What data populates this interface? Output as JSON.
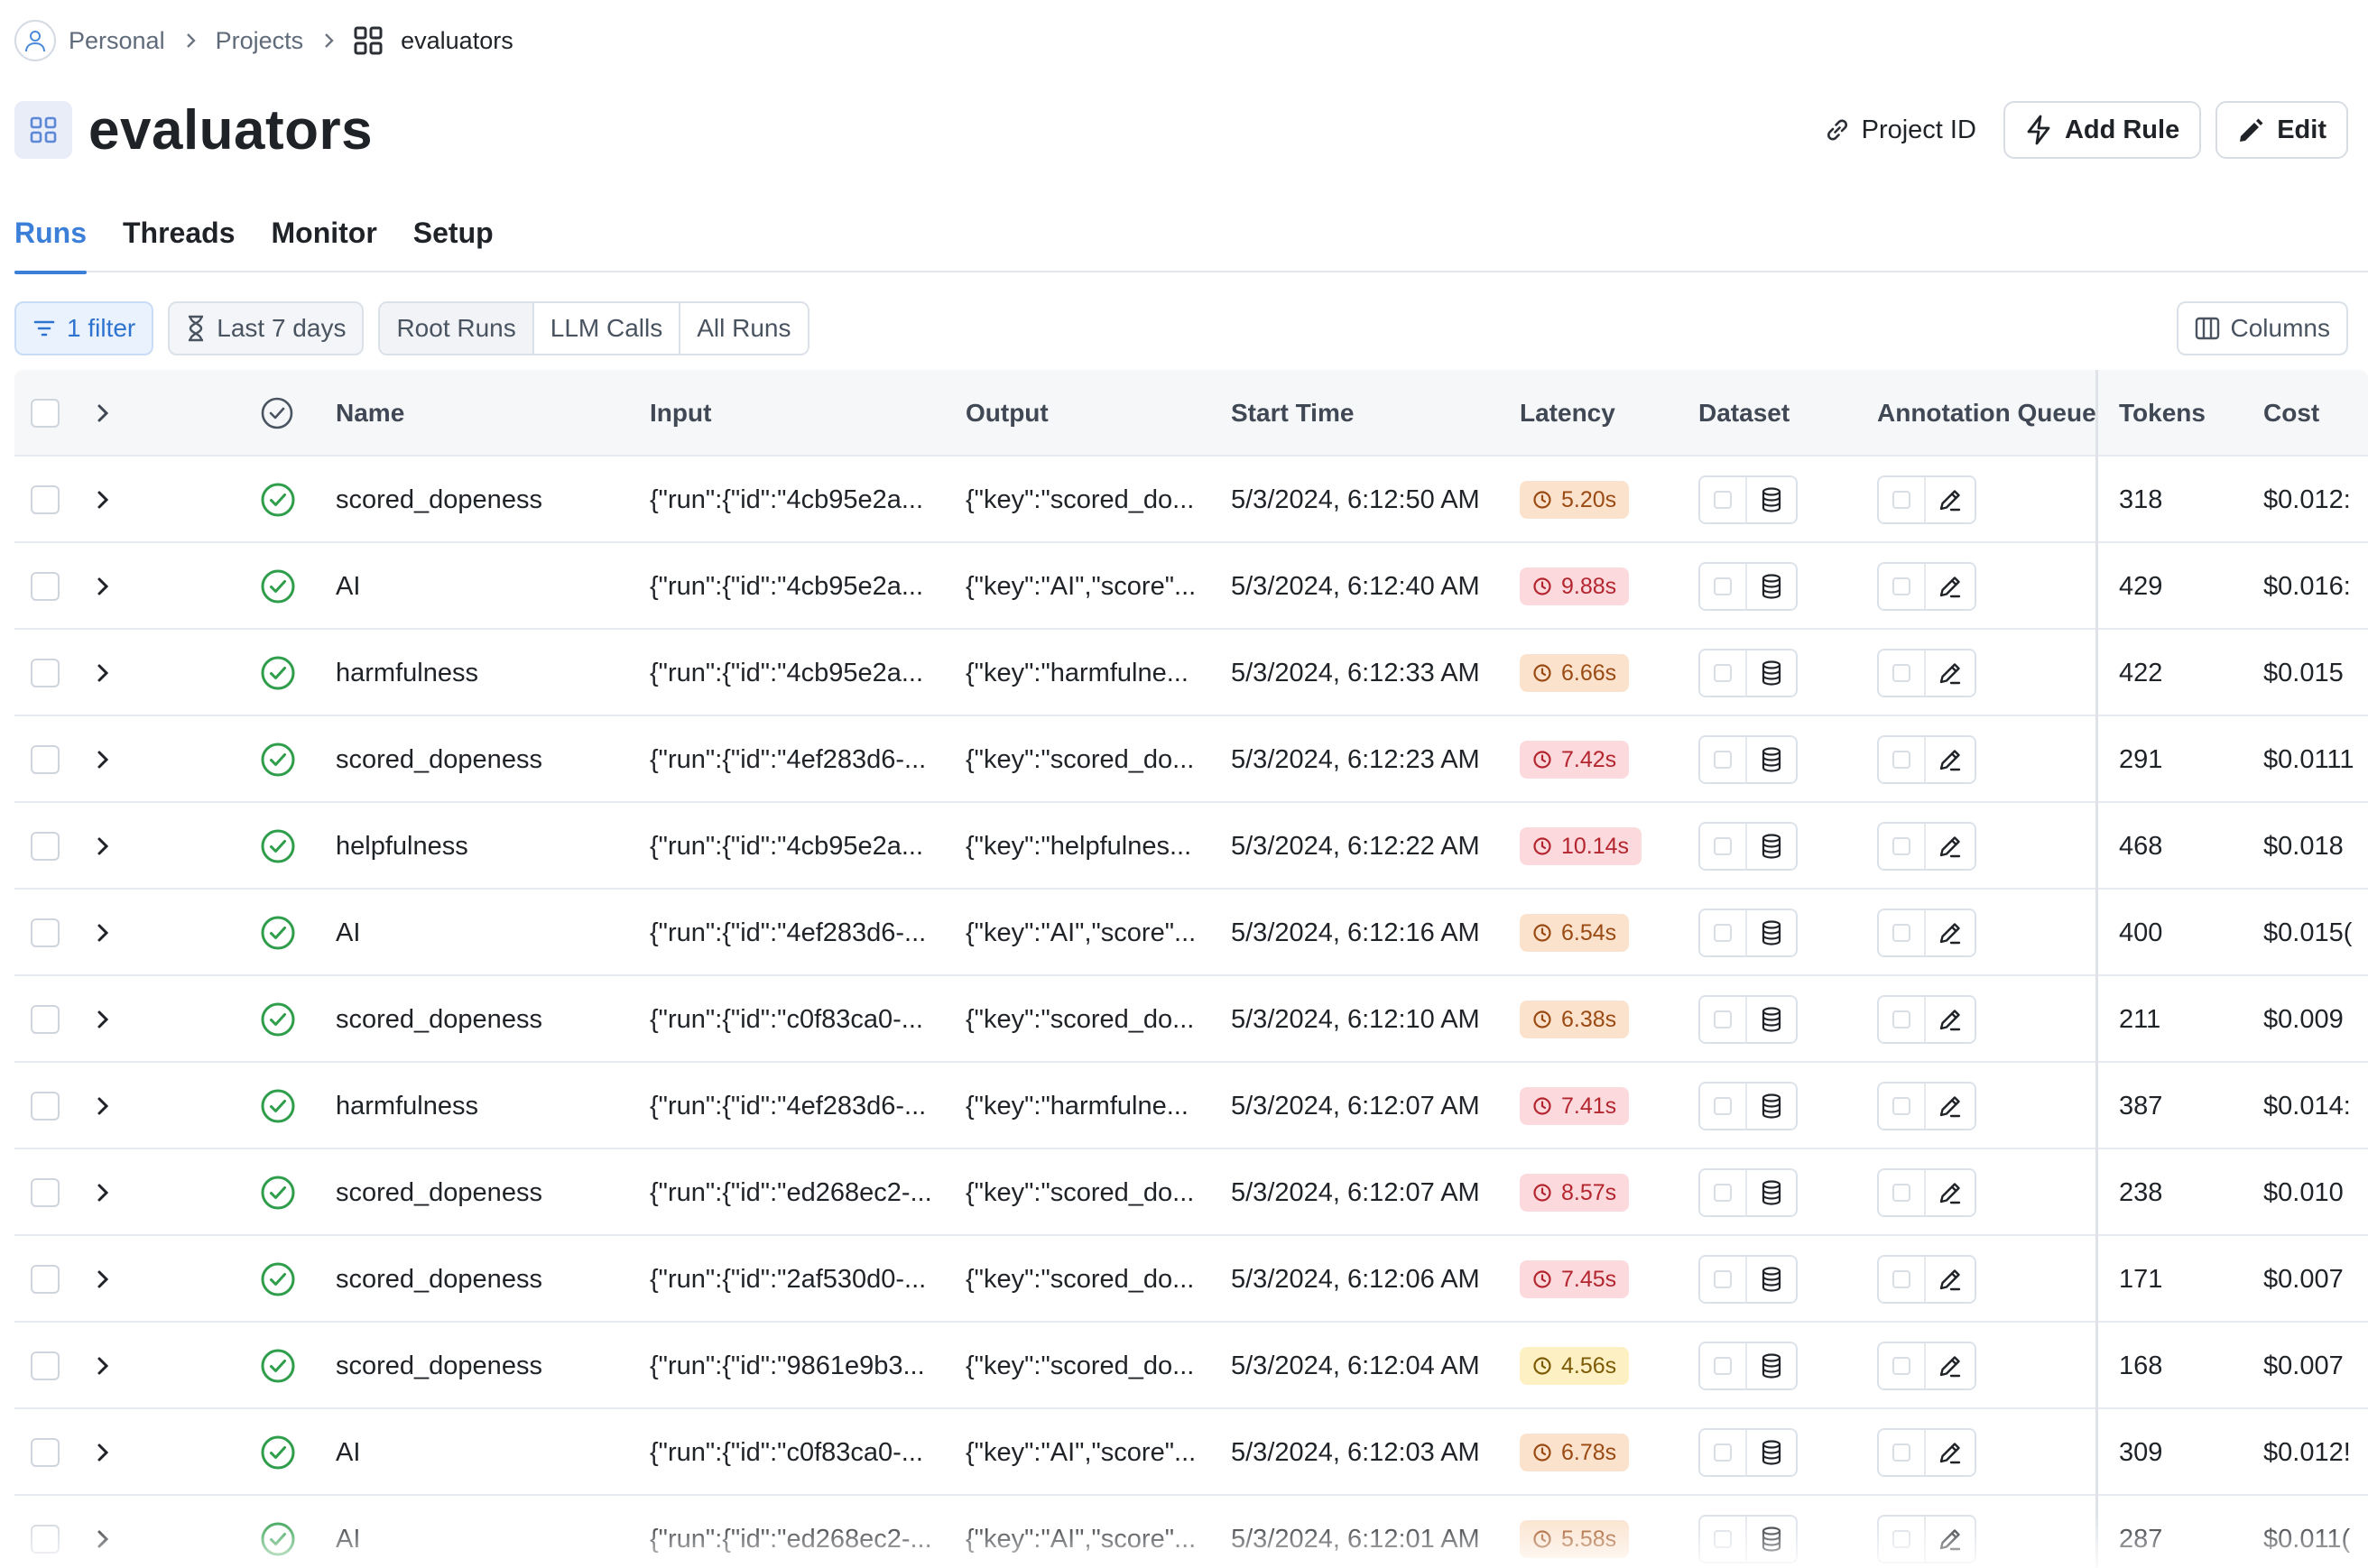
{
  "breadcrumb": {
    "items": [
      "Personal",
      "Projects"
    ],
    "current": "evaluators"
  },
  "header": {
    "title": "evaluators",
    "project_id_label": "Project ID",
    "add_rule_label": "Add Rule",
    "edit_label": "Edit"
  },
  "tabs": [
    {
      "label": "Runs",
      "active": true
    },
    {
      "label": "Threads",
      "active": false
    },
    {
      "label": "Monitor",
      "active": false
    },
    {
      "label": "Setup",
      "active": false
    }
  ],
  "toolbar": {
    "filter_label": "1 filter",
    "range_label": "Last 7 days",
    "run_types": [
      "Root Runs",
      "LLM Calls",
      "All Runs"
    ],
    "active_run_type": "Root Runs",
    "columns_label": "Columns"
  },
  "table": {
    "headers": {
      "name": "Name",
      "input": "Input",
      "output": "Output",
      "start": "Start Time",
      "latency": "Latency",
      "dataset": "Dataset",
      "queue": "Annotation Queue",
      "tokens": "Tokens",
      "cost": "Cost"
    },
    "rows": [
      {
        "name": "scored_dopeness",
        "input": "{\"run\":{\"id\":\"4cb95e2a...",
        "output": "{\"key\":\"scored_do...",
        "start": "5/3/2024, 6:12:50 AM",
        "latency": "5.20s",
        "latency_level": "orange",
        "tokens": "318",
        "cost": "$0.012:"
      },
      {
        "name": "AI",
        "input": "{\"run\":{\"id\":\"4cb95e2a...",
        "output": "{\"key\":\"AI\",\"score\"...",
        "start": "5/3/2024, 6:12:40 AM",
        "latency": "9.88s",
        "latency_level": "red",
        "tokens": "429",
        "cost": "$0.016:"
      },
      {
        "name": "harmfulness",
        "input": "{\"run\":{\"id\":\"4cb95e2a...",
        "output": "{\"key\":\"harmfulne...",
        "start": "5/3/2024, 6:12:33 AM",
        "latency": "6.66s",
        "latency_level": "orange",
        "tokens": "422",
        "cost": "$0.015"
      },
      {
        "name": "scored_dopeness",
        "input": "{\"run\":{\"id\":\"4ef283d6-...",
        "output": "{\"key\":\"scored_do...",
        "start": "5/3/2024, 6:12:23 AM",
        "latency": "7.42s",
        "latency_level": "red",
        "tokens": "291",
        "cost": "$0.0111"
      },
      {
        "name": "helpfulness",
        "input": "{\"run\":{\"id\":\"4cb95e2a...",
        "output": "{\"key\":\"helpfulnes...",
        "start": "5/3/2024, 6:12:22 AM",
        "latency": "10.14s",
        "latency_level": "red",
        "tokens": "468",
        "cost": "$0.018"
      },
      {
        "name": "AI",
        "input": "{\"run\":{\"id\":\"4ef283d6-...",
        "output": "{\"key\":\"AI\",\"score\"...",
        "start": "5/3/2024, 6:12:16 AM",
        "latency": "6.54s",
        "latency_level": "orange",
        "tokens": "400",
        "cost": "$0.015("
      },
      {
        "name": "scored_dopeness",
        "input": "{\"run\":{\"id\":\"c0f83ca0-...",
        "output": "{\"key\":\"scored_do...",
        "start": "5/3/2024, 6:12:10 AM",
        "latency": "6.38s",
        "latency_level": "orange",
        "tokens": "211",
        "cost": "$0.009"
      },
      {
        "name": "harmfulness",
        "input": "{\"run\":{\"id\":\"4ef283d6-...",
        "output": "{\"key\":\"harmfulne...",
        "start": "5/3/2024, 6:12:07 AM",
        "latency": "7.41s",
        "latency_level": "red",
        "tokens": "387",
        "cost": "$0.014:"
      },
      {
        "name": "scored_dopeness",
        "input": "{\"run\":{\"id\":\"ed268ec2-...",
        "output": "{\"key\":\"scored_do...",
        "start": "5/3/2024, 6:12:07 AM",
        "latency": "8.57s",
        "latency_level": "red",
        "tokens": "238",
        "cost": "$0.010"
      },
      {
        "name": "scored_dopeness",
        "input": "{\"run\":{\"id\":\"2af530d0-...",
        "output": "{\"key\":\"scored_do...",
        "start": "5/3/2024, 6:12:06 AM",
        "latency": "7.45s",
        "latency_level": "red",
        "tokens": "171",
        "cost": "$0.007"
      },
      {
        "name": "scored_dopeness",
        "input": "{\"run\":{\"id\":\"9861e9b3...",
        "output": "{\"key\":\"scored_do...",
        "start": "5/3/2024, 6:12:04 AM",
        "latency": "4.56s",
        "latency_level": "yellow",
        "tokens": "168",
        "cost": "$0.007"
      },
      {
        "name": "AI",
        "input": "{\"run\":{\"id\":\"c0f83ca0-...",
        "output": "{\"key\":\"AI\",\"score\"...",
        "start": "5/3/2024, 6:12:03 AM",
        "latency": "6.78s",
        "latency_level": "orange",
        "tokens": "309",
        "cost": "$0.012!"
      },
      {
        "name": "AI",
        "input": "{\"run\":{\"id\":\"ed268ec2-...",
        "output": "{\"key\":\"AI\",\"score\"...",
        "start": "5/3/2024, 6:12:01 AM",
        "latency": "5.58s",
        "latency_level": "orange",
        "tokens": "287",
        "cost": "$0.011("
      }
    ]
  },
  "colors": {
    "accent": "#3b7fd9",
    "success": "#2e9e4b",
    "latency_orange_bg": "#fbe2cd",
    "latency_red_bg": "#fbd9dc",
    "latency_yellow_bg": "#fdf1c4"
  }
}
